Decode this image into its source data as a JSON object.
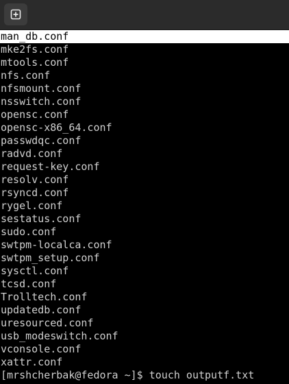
{
  "titlebar": {
    "new_tab_icon": "plus-square-icon"
  },
  "terminal": {
    "selected_index": 0,
    "lines": [
      "man_db.conf",
      "mke2fs.conf",
      "mtools.conf",
      "nfs.conf",
      "nfsmount.conf",
      "nsswitch.conf",
      "opensc.conf",
      "opensc-x86_64.conf",
      "passwdqc.conf",
      "radvd.conf",
      "request-key.conf",
      "resolv.conf",
      "rsyncd.conf",
      "rygel.conf",
      "sestatus.conf",
      "sudo.conf",
      "swtpm-localca.conf",
      "swtpm_setup.conf",
      "sysctl.conf",
      "tcsd.conf",
      "Trolltech.conf",
      "updatedb.conf",
      "uresourced.conf",
      "usb_modeswitch.conf",
      "vconsole.conf",
      "xattr.conf"
    ],
    "prompt": {
      "text": "[mrshcherbak@fedora ~]$ touch outputf.txt"
    }
  },
  "colors": {
    "background": "#000000",
    "text": "#d0d0d0",
    "selection_bg": "#ffffff",
    "titlebar_bg": "#2b2b2b"
  }
}
